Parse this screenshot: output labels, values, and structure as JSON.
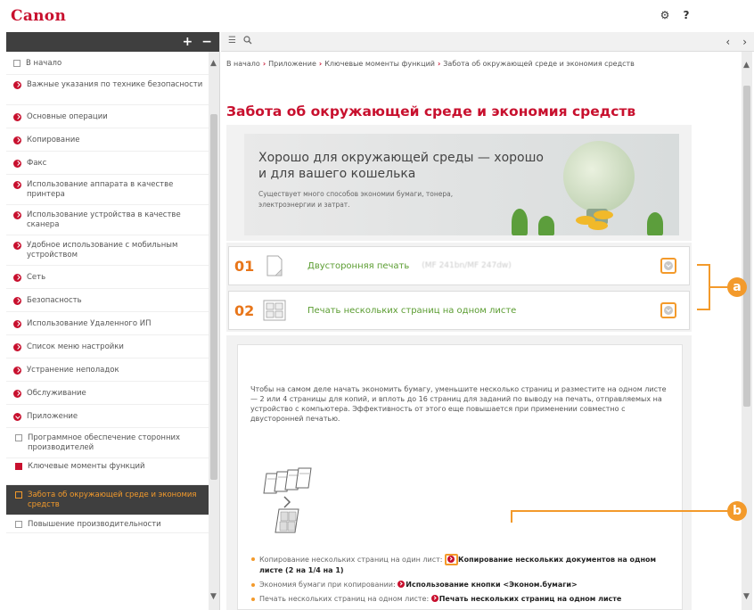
{
  "brand": {
    "logo": "Canon"
  },
  "top_icons": {
    "settings": "⚙",
    "help": "?"
  },
  "sidebar": {
    "expand": "+",
    "collapse": "−",
    "items": [
      {
        "label": "В начало",
        "icon": "home"
      },
      {
        "label": "Важные указания по технике безопасности",
        "icon": "chevron"
      },
      {
        "label": "Основные операции",
        "icon": "chevron"
      },
      {
        "label": "Копирование",
        "icon": "chevron"
      },
      {
        "label": "Факс",
        "icon": "chevron"
      },
      {
        "label": "Использование аппарата в качестве принтера",
        "icon": "chevron"
      },
      {
        "label": "Использование устройства в качестве сканера",
        "icon": "chevron"
      },
      {
        "label": "Удобное использование с мобильным устройством",
        "icon": "chevron"
      },
      {
        "label": "Сеть",
        "icon": "chevron"
      },
      {
        "label": "Безопасность",
        "icon": "chevron"
      },
      {
        "label": "Использование Удаленного ИП",
        "icon": "chevron"
      },
      {
        "label": "Список меню настройки",
        "icon": "chevron"
      },
      {
        "label": "Устранение неполадок",
        "icon": "chevron"
      },
      {
        "label": "Обслуживание",
        "icon": "chevron"
      },
      {
        "label": "Приложение",
        "icon": "chevron-open"
      },
      {
        "label": "Программное обеспечение сторонних производителей",
        "icon": "page"
      },
      {
        "label": "Ключевые моменты функций",
        "icon": "page-red"
      },
      {
        "label": "Забота об окружающей среде и экономия средств",
        "icon": "page",
        "active": true
      },
      {
        "label": "Повышение производительности",
        "icon": "page"
      }
    ]
  },
  "toolbar": {
    "list_icon": "☰",
    "search_icon": "🔍",
    "prev": "‹",
    "next": "›"
  },
  "breadcrumb": {
    "items": [
      "В начало",
      "Приложение",
      "Ключевые моменты функций",
      "Забота об окружающей среде и экономия средств"
    ],
    "separator": "›"
  },
  "page_title": "Забота об окружающей среде и экономия средств",
  "hero": {
    "heading": "Хорошо для окружающей среды — хорошо и для вашего кошелька",
    "text": "Существует много способов экономии бумаги, тонера, электроэнергии и затрат."
  },
  "features": [
    {
      "number": "01",
      "label": "Двусторонняя печать",
      "note": "(MF 241bn/MF 247dw)"
    },
    {
      "number": "02",
      "label": "Печать нескольких страниц на одном листе",
      "note": ""
    }
  ],
  "callouts": {
    "a": "a",
    "b": "b"
  },
  "detail": {
    "paragraph": "Чтобы на самом деле начать экономить бумагу, уменьшите несколько страниц и разместите на одном листе — 2 или 4 страницы для копий, и вплоть до 16 страниц для заданий по выводу на печать, отправляемых на устройство с компьютера. Эффективность от этого еще повышается при применении совместно с двусторонней печатью.",
    "bullets": [
      {
        "text": "Копирование нескольких страниц на один лист: ",
        "link": "Копирование нескольких документов на одном листе (2 на 1/4 на 1)"
      },
      {
        "text": "Экономия бумаги при копировании: ",
        "link": "Использование кнопки <Эконом.бумаги>"
      },
      {
        "text": "Печать нескольких страниц на одном листе: ",
        "link": "Печать нескольких страниц на одном листе"
      }
    ]
  },
  "colors": {
    "brand": "#c8102e",
    "accent": "#f39a2b",
    "link_green": "#5a9c30",
    "sidebar_active": "#3f3f3f"
  }
}
